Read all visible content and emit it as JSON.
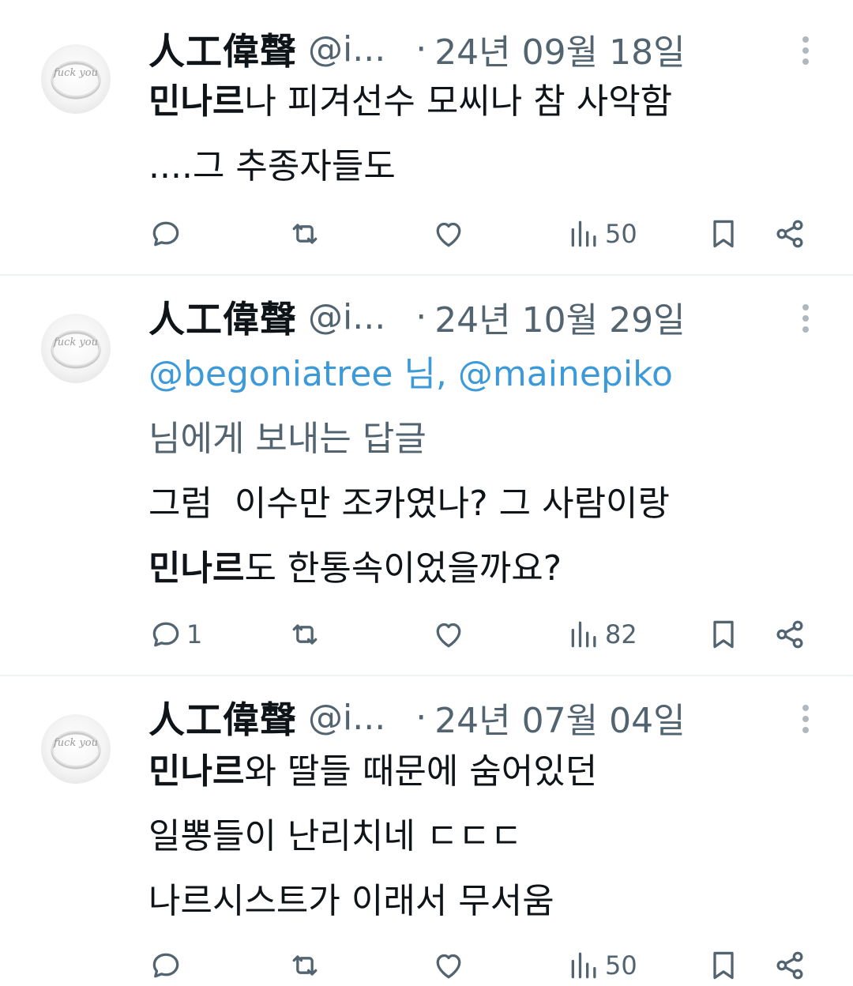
{
  "tweets": [
    {
      "display_name": "人工偉聲",
      "handle": "@i...",
      "dot": "·",
      "date": "24년 09월 18일",
      "lines": [
        {
          "bold": "민나르",
          "rest": "나 피겨선수 모씨나 참 사악함"
        },
        {
          "bold": "",
          "rest": "....그 추종자들도"
        }
      ],
      "reply_count": "",
      "views": "50"
    },
    {
      "display_name": "人工偉聲",
      "handle": "@i...",
      "dot": "·",
      "date": "24년 10월 29일",
      "mention_1": "@begoniatree",
      "mention_sep": " 님, ",
      "mention_2": "@mainepiko",
      "reply_suffix": "님에게 보내는 답글",
      "lines": [
        {
          "bold": "",
          "rest": "그럼  이수만 조카였나? 그 사람이랑"
        },
        {
          "bold": "민나르",
          "rest": "도 한통속이었을까요?"
        }
      ],
      "reply_count": "1",
      "views": "82"
    },
    {
      "display_name": "人工偉聲",
      "handle": "@i...",
      "dot": "·",
      "date": "24년 07월 04일",
      "lines": [
        {
          "bold": "민나르",
          "rest": "와 딸들 때문에 숨어있던"
        },
        {
          "bold": "",
          "rest": "일뽕들이 난리치네 ㄷㄷㄷ"
        },
        {
          "bold": "",
          "rest": "나르시스트가 이래서 무서움"
        }
      ],
      "reply_count": "",
      "views": "50"
    }
  ],
  "avatar_text": "fuck you",
  "icons": {
    "reply": "reply-icon",
    "retweet": "retweet-icon",
    "like": "heart-icon",
    "views": "views-chart-icon",
    "bookmark": "bookmark-icon",
    "share": "share-icon",
    "more": "more-vertical-icon"
  },
  "colors": {
    "text": "#0f1419",
    "secondary": "#536471",
    "link": "#3d9ad9",
    "divider": "#eff3f4"
  }
}
